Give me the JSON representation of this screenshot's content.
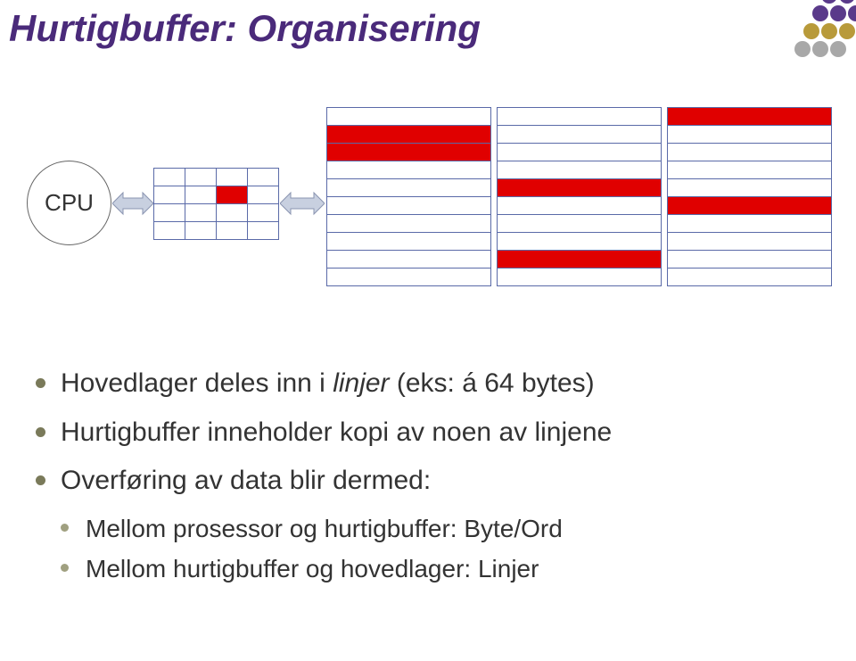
{
  "title": "Hurtigbuffer: Organisering",
  "diagram": {
    "cpu_label": "CPU",
    "cache": {
      "rows": 4,
      "cols": 4,
      "filled_cells": [
        [
          1,
          2
        ]
      ]
    },
    "memory": {
      "cols": 3,
      "rows_per_col": 10,
      "filled_rows": {
        "0": [
          1,
          2
        ],
        "1": [
          4,
          8
        ],
        "2": [
          0,
          5
        ]
      }
    },
    "logo_colors": [
      "#5a3a8a",
      "#5a3a8a",
      "#5a3a8a",
      "#5a3a8a",
      "#b89a3a",
      "#b89a3a",
      "#b89a3a",
      "#a8a8a8",
      "#a8a8a8"
    ]
  },
  "bullets": {
    "b1_pre": "Hovedlager deles inn i ",
    "b1_it": "linjer",
    "b1_post": " (eks: á 64 bytes)",
    "b2": "Hurtigbuffer inneholder kopi av noen av linjene",
    "b3": "Overføring av data blir dermed:",
    "b3a": "Mellom prosessor og hurtigbuffer: Byte/Ord",
    "b3b": "Mellom hurtigbuffer og hovedlager: Linjer"
  }
}
